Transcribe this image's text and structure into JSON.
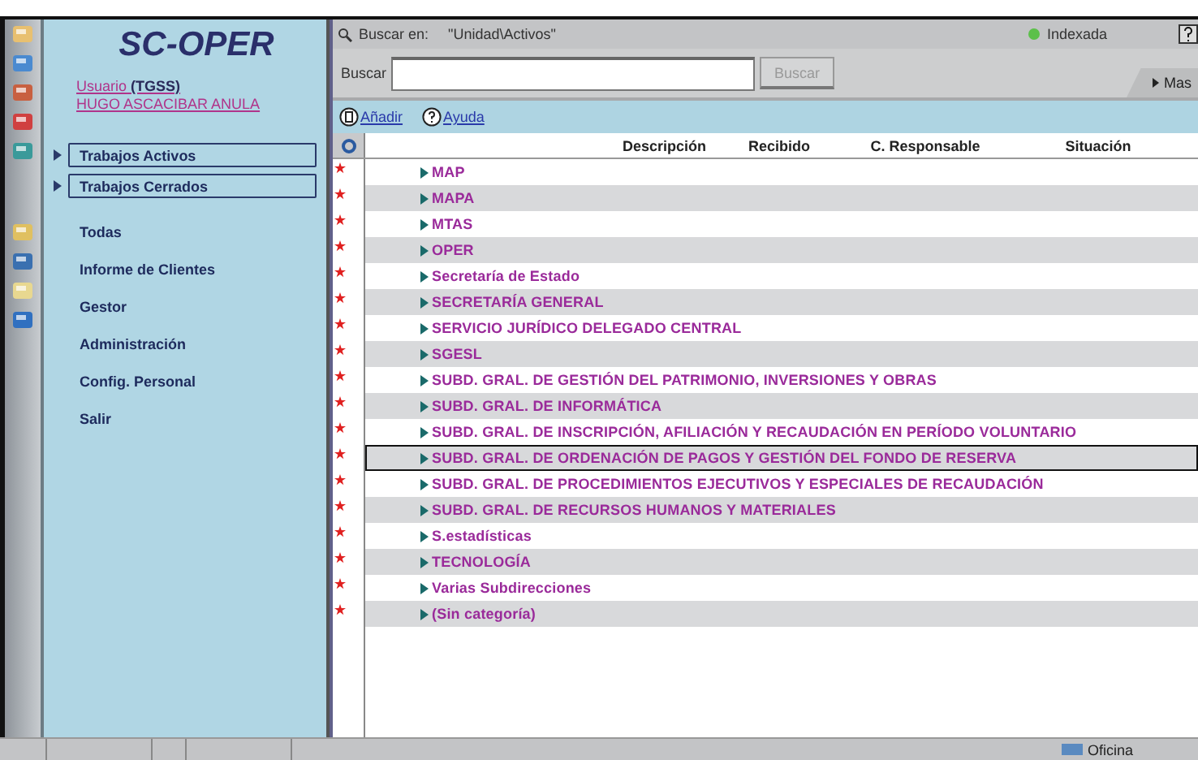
{
  "sidebar": {
    "title": "SC-OPER",
    "user_label": "Usuario",
    "user_org": "(TGSS)",
    "user_name": "HUGO ASCACIBAR ANULA",
    "items": [
      {
        "label": "Trabajos Activos",
        "kind": "group"
      },
      {
        "label": "Trabajos Cerrados",
        "kind": "group"
      },
      {
        "label": "Todas",
        "kind": "link"
      },
      {
        "label": "Informe de Clientes",
        "kind": "link"
      },
      {
        "label": "Gestor",
        "kind": "link"
      },
      {
        "label": "Administración",
        "kind": "link"
      },
      {
        "label": "Config. Personal",
        "kind": "link"
      },
      {
        "label": "Salir",
        "kind": "link"
      }
    ]
  },
  "search_scope": {
    "label": "Buscar en:",
    "value": "\"Unidad\\Activos\""
  },
  "index_status": {
    "label": "Indexada",
    "on": true
  },
  "search": {
    "label": "Buscar",
    "button": "Buscar",
    "button_disabled": true
  },
  "more_tab": "Mas",
  "actions": [
    "Añadir",
    "Ayuda"
  ],
  "table": {
    "columns": [
      "Descripción",
      "Recibido",
      "C. Responsable",
      "Situación"
    ],
    "rows": [
      {
        "text": "MAP",
        "selected": false
      },
      {
        "text": "MAPA",
        "selected": false
      },
      {
        "text": "MTAS",
        "selected": false
      },
      {
        "text": "OPER",
        "selected": false
      },
      {
        "text": "Secretaría de Estado",
        "selected": false
      },
      {
        "text": "SECRETARÍA GENERAL",
        "selected": false
      },
      {
        "text": "SERVICIO JURÍDICO DELEGADO CENTRAL",
        "selected": false
      },
      {
        "text": "SGESL",
        "selected": false
      },
      {
        "text": "SUBD. GRAL. DE GESTIÓN DEL PATRIMONIO, INVERSIONES Y OBRAS",
        "selected": false
      },
      {
        "text": "SUBD. GRAL. DE INFORMÁTICA",
        "selected": false
      },
      {
        "text": "SUBD. GRAL. DE INSCRIPCIÓN, AFILIACIÓN Y RECAUDACIÓN EN PERÍODO VOLUNTARIO",
        "selected": false
      },
      {
        "text": "SUBD. GRAL. DE ORDENACIÓN DE PAGOS Y GESTIÓN DEL FONDO DE RESERVA",
        "selected": true
      },
      {
        "text": "SUBD. GRAL. DE PROCEDIMIENTOS EJECUTIVOS Y ESPECIALES DE RECAUDACIÓN",
        "selected": false
      },
      {
        "text": "SUBD. GRAL. DE RECURSOS HUMANOS Y MATERIALES",
        "selected": false
      },
      {
        "text": "S.estadísticas",
        "selected": false
      },
      {
        "text": "TECNOLOGÍA",
        "selected": false
      },
      {
        "text": "Varias Subdirecciones",
        "selected": false
      },
      {
        "text": "(Sin categoría)",
        "selected": false
      }
    ]
  },
  "status_bar": {
    "label": "Oficina"
  }
}
